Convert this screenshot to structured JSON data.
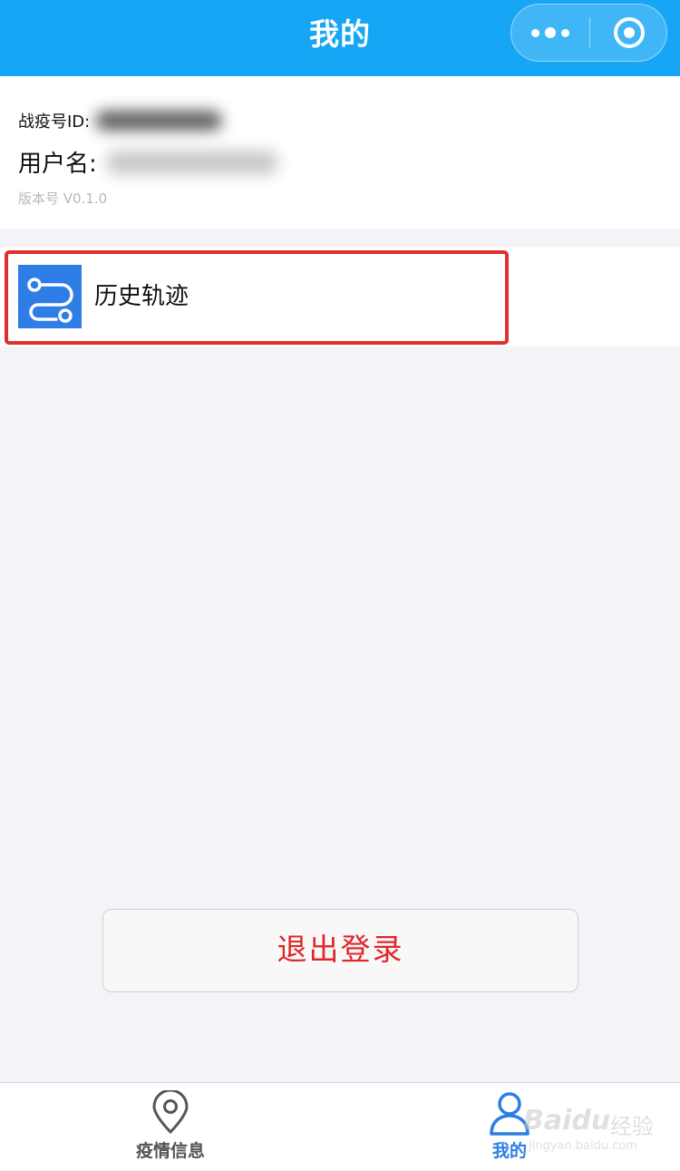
{
  "navbar": {
    "title": "我的",
    "more_icon": "more-dots-icon",
    "close_icon": "circle-target-icon",
    "background": "#16a6f5"
  },
  "profile": {
    "id_label": "战疫号ID:",
    "username_label": "用户名:",
    "version": "版本号 V0.1.0"
  },
  "menu": {
    "history": {
      "label": "历史轨迹",
      "icon": "route-icon",
      "icon_color": "#2f7de6"
    }
  },
  "logout": {
    "label": "退出登录",
    "color": "#e0262a"
  },
  "tabbar": {
    "tabs": [
      {
        "label": "疫情信息",
        "icon": "location-pin-icon",
        "active": false
      },
      {
        "label": "我的",
        "icon": "user-icon",
        "active": true
      }
    ],
    "active_color": "#2c7ee5"
  },
  "watermark": {
    "logo": "Baidu",
    "text": "经验",
    "url": "jingyan.baidu.com"
  }
}
